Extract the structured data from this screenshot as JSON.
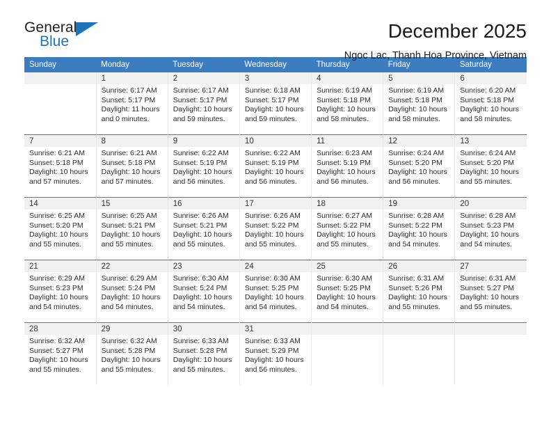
{
  "brand": {
    "name_part1": "General",
    "name_part2": "Blue"
  },
  "header": {
    "title": "December 2025",
    "subtitle": "Ngoc Lac, Thanh Hoa Province, Vietnam"
  },
  "colors": {
    "header_blue": "#3c7dc0",
    "brand_blue": "#1c74bc",
    "daynum_band": "#f1f1f1"
  },
  "weekdays": [
    "Sunday",
    "Monday",
    "Tuesday",
    "Wednesday",
    "Thursday",
    "Friday",
    "Saturday"
  ],
  "weeks": [
    [
      {
        "day": "",
        "empty": true
      },
      {
        "day": "1",
        "sunrise": "Sunrise: 6:17 AM",
        "sunset": "Sunset: 5:17 PM",
        "daylight1": "Daylight: 11 hours",
        "daylight2": "and 0 minutes."
      },
      {
        "day": "2",
        "sunrise": "Sunrise: 6:17 AM",
        "sunset": "Sunset: 5:17 PM",
        "daylight1": "Daylight: 10 hours",
        "daylight2": "and 59 minutes."
      },
      {
        "day": "3",
        "sunrise": "Sunrise: 6:18 AM",
        "sunset": "Sunset: 5:17 PM",
        "daylight1": "Daylight: 10 hours",
        "daylight2": "and 59 minutes."
      },
      {
        "day": "4",
        "sunrise": "Sunrise: 6:19 AM",
        "sunset": "Sunset: 5:18 PM",
        "daylight1": "Daylight: 10 hours",
        "daylight2": "and 58 minutes."
      },
      {
        "day": "5",
        "sunrise": "Sunrise: 6:19 AM",
        "sunset": "Sunset: 5:18 PM",
        "daylight1": "Daylight: 10 hours",
        "daylight2": "and 58 minutes."
      },
      {
        "day": "6",
        "sunrise": "Sunrise: 6:20 AM",
        "sunset": "Sunset: 5:18 PM",
        "daylight1": "Daylight: 10 hours",
        "daylight2": "and 58 minutes."
      }
    ],
    [
      {
        "day": "7",
        "sunrise": "Sunrise: 6:21 AM",
        "sunset": "Sunset: 5:18 PM",
        "daylight1": "Daylight: 10 hours",
        "daylight2": "and 57 minutes."
      },
      {
        "day": "8",
        "sunrise": "Sunrise: 6:21 AM",
        "sunset": "Sunset: 5:18 PM",
        "daylight1": "Daylight: 10 hours",
        "daylight2": "and 57 minutes."
      },
      {
        "day": "9",
        "sunrise": "Sunrise: 6:22 AM",
        "sunset": "Sunset: 5:19 PM",
        "daylight1": "Daylight: 10 hours",
        "daylight2": "and 56 minutes."
      },
      {
        "day": "10",
        "sunrise": "Sunrise: 6:22 AM",
        "sunset": "Sunset: 5:19 PM",
        "daylight1": "Daylight: 10 hours",
        "daylight2": "and 56 minutes."
      },
      {
        "day": "11",
        "sunrise": "Sunrise: 6:23 AM",
        "sunset": "Sunset: 5:19 PM",
        "daylight1": "Daylight: 10 hours",
        "daylight2": "and 56 minutes."
      },
      {
        "day": "12",
        "sunrise": "Sunrise: 6:24 AM",
        "sunset": "Sunset: 5:20 PM",
        "daylight1": "Daylight: 10 hours",
        "daylight2": "and 56 minutes."
      },
      {
        "day": "13",
        "sunrise": "Sunrise: 6:24 AM",
        "sunset": "Sunset: 5:20 PM",
        "daylight1": "Daylight: 10 hours",
        "daylight2": "and 55 minutes."
      }
    ],
    [
      {
        "day": "14",
        "sunrise": "Sunrise: 6:25 AM",
        "sunset": "Sunset: 5:20 PM",
        "daylight1": "Daylight: 10 hours",
        "daylight2": "and 55 minutes."
      },
      {
        "day": "15",
        "sunrise": "Sunrise: 6:25 AM",
        "sunset": "Sunset: 5:21 PM",
        "daylight1": "Daylight: 10 hours",
        "daylight2": "and 55 minutes."
      },
      {
        "day": "16",
        "sunrise": "Sunrise: 6:26 AM",
        "sunset": "Sunset: 5:21 PM",
        "daylight1": "Daylight: 10 hours",
        "daylight2": "and 55 minutes."
      },
      {
        "day": "17",
        "sunrise": "Sunrise: 6:26 AM",
        "sunset": "Sunset: 5:22 PM",
        "daylight1": "Daylight: 10 hours",
        "daylight2": "and 55 minutes."
      },
      {
        "day": "18",
        "sunrise": "Sunrise: 6:27 AM",
        "sunset": "Sunset: 5:22 PM",
        "daylight1": "Daylight: 10 hours",
        "daylight2": "and 55 minutes."
      },
      {
        "day": "19",
        "sunrise": "Sunrise: 6:28 AM",
        "sunset": "Sunset: 5:22 PM",
        "daylight1": "Daylight: 10 hours",
        "daylight2": "and 54 minutes."
      },
      {
        "day": "20",
        "sunrise": "Sunrise: 6:28 AM",
        "sunset": "Sunset: 5:23 PM",
        "daylight1": "Daylight: 10 hours",
        "daylight2": "and 54 minutes."
      }
    ],
    [
      {
        "day": "21",
        "sunrise": "Sunrise: 6:29 AM",
        "sunset": "Sunset: 5:23 PM",
        "daylight1": "Daylight: 10 hours",
        "daylight2": "and 54 minutes."
      },
      {
        "day": "22",
        "sunrise": "Sunrise: 6:29 AM",
        "sunset": "Sunset: 5:24 PM",
        "daylight1": "Daylight: 10 hours",
        "daylight2": "and 54 minutes."
      },
      {
        "day": "23",
        "sunrise": "Sunrise: 6:30 AM",
        "sunset": "Sunset: 5:24 PM",
        "daylight1": "Daylight: 10 hours",
        "daylight2": "and 54 minutes."
      },
      {
        "day": "24",
        "sunrise": "Sunrise: 6:30 AM",
        "sunset": "Sunset: 5:25 PM",
        "daylight1": "Daylight: 10 hours",
        "daylight2": "and 54 minutes."
      },
      {
        "day": "25",
        "sunrise": "Sunrise: 6:30 AM",
        "sunset": "Sunset: 5:25 PM",
        "daylight1": "Daylight: 10 hours",
        "daylight2": "and 54 minutes."
      },
      {
        "day": "26",
        "sunrise": "Sunrise: 6:31 AM",
        "sunset": "Sunset: 5:26 PM",
        "daylight1": "Daylight: 10 hours",
        "daylight2": "and 55 minutes."
      },
      {
        "day": "27",
        "sunrise": "Sunrise: 6:31 AM",
        "sunset": "Sunset: 5:27 PM",
        "daylight1": "Daylight: 10 hours",
        "daylight2": "and 55 minutes."
      }
    ],
    [
      {
        "day": "28",
        "sunrise": "Sunrise: 6:32 AM",
        "sunset": "Sunset: 5:27 PM",
        "daylight1": "Daylight: 10 hours",
        "daylight2": "and 55 minutes."
      },
      {
        "day": "29",
        "sunrise": "Sunrise: 6:32 AM",
        "sunset": "Sunset: 5:28 PM",
        "daylight1": "Daylight: 10 hours",
        "daylight2": "and 55 minutes."
      },
      {
        "day": "30",
        "sunrise": "Sunrise: 6:33 AM",
        "sunset": "Sunset: 5:28 PM",
        "daylight1": "Daylight: 10 hours",
        "daylight2": "and 55 minutes."
      },
      {
        "day": "31",
        "sunrise": "Sunrise: 6:33 AM",
        "sunset": "Sunset: 5:29 PM",
        "daylight1": "Daylight: 10 hours",
        "daylight2": "and 56 minutes."
      },
      {
        "day": "",
        "empty": true
      },
      {
        "day": "",
        "empty": true
      },
      {
        "day": "",
        "empty": true
      }
    ]
  ]
}
